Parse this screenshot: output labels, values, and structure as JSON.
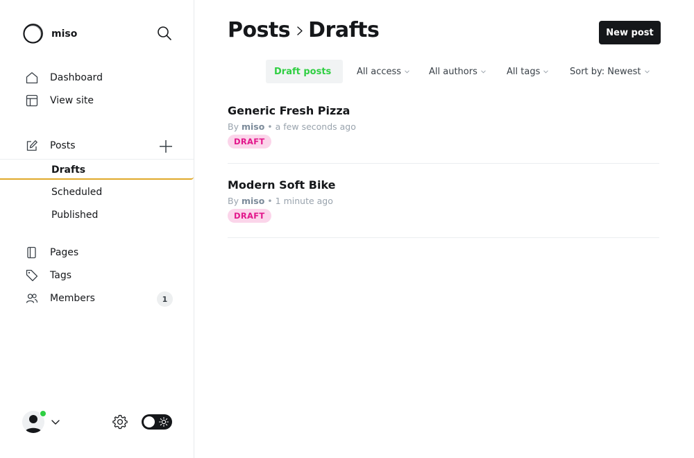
{
  "site": {
    "name": "miso"
  },
  "nav": {
    "dashboard": "Dashboard",
    "view_site": "View site",
    "posts": "Posts",
    "post_subitems": [
      "Drafts",
      "Scheduled",
      "Published"
    ],
    "pages": "Pages",
    "tags": "Tags",
    "members": "Members",
    "members_count": "1"
  },
  "header": {
    "crumb_parent": "Posts",
    "crumb_current": "Drafts",
    "new_post_label": "New post"
  },
  "filters": [
    {
      "label": "Draft posts",
      "active": true
    },
    {
      "label": "All access"
    },
    {
      "label": "All authors"
    },
    {
      "label": "All tags"
    },
    {
      "label": "Sort by: Newest"
    }
  ],
  "posts": [
    {
      "title": "Generic Fresh Pizza",
      "by": "By",
      "author": "miso",
      "time": "• a few seconds ago",
      "status": "DRAFT"
    },
    {
      "title": "Modern Soft Bike",
      "by": "By",
      "author": "miso",
      "time": "• 1 minute ago",
      "status": "DRAFT"
    }
  ],
  "icons": {
    "brand": "circle-logo-icon",
    "search": "search-icon",
    "dashboard": "home-icon",
    "view_site": "browser-layout-icon",
    "posts": "pencil-square-icon",
    "add": "plus-icon",
    "pages": "page-icon",
    "tags": "tag-icon",
    "members": "users-icon",
    "settings": "gear-icon",
    "theme": "sun-icon"
  },
  "colors": {
    "accent_active_filter": "#30cf43",
    "draft_pill_bg": "#fbd5ea",
    "draft_pill_text": "#e2168b",
    "active_underline": "#e0a92a",
    "primary_button": "#15171a"
  }
}
